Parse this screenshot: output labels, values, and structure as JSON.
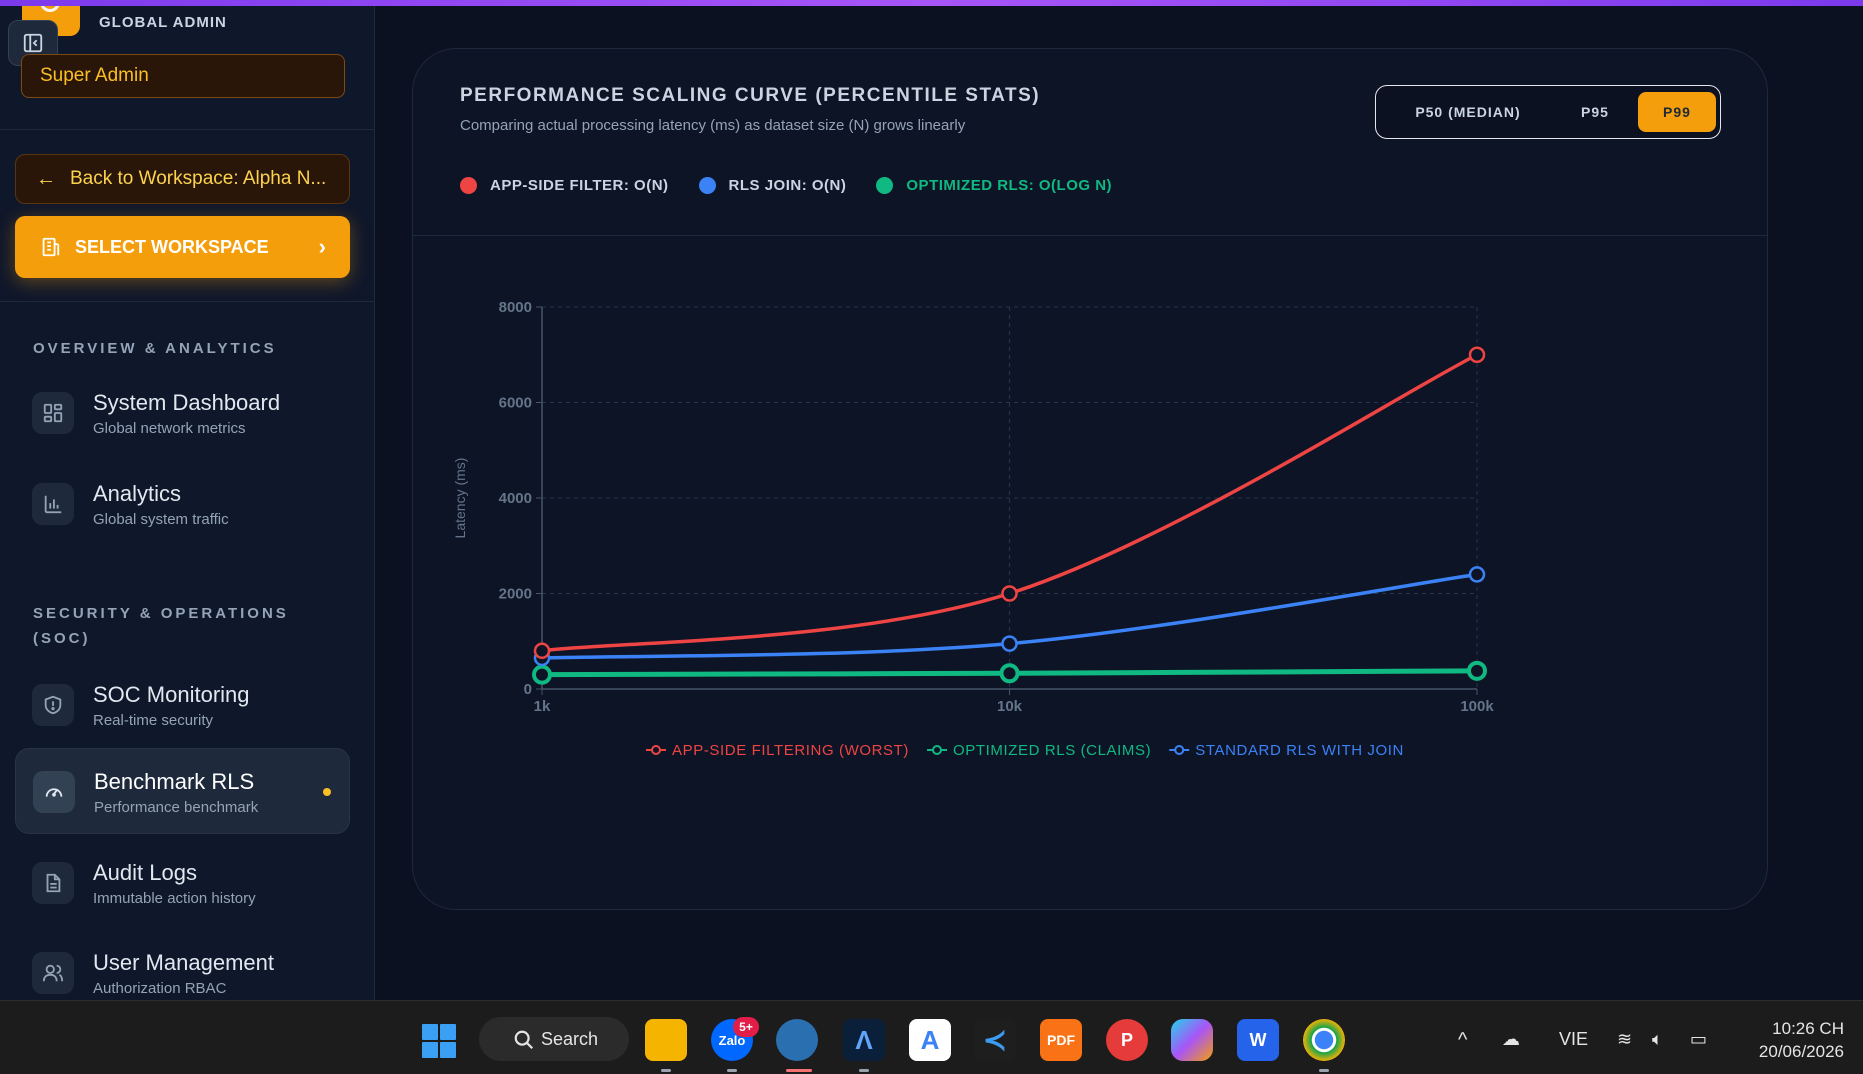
{
  "sidebar": {
    "role_header": "GLOBAL ADMIN",
    "role_badge": "Super Admin",
    "back_label": "Back to Workspace: Alpha N...",
    "select_label": "SELECT WORKSPACE",
    "sections": [
      {
        "title": "OVERVIEW & ANALYTICS"
      },
      {
        "title": "SECURITY & OPERATIONS (SOC)"
      }
    ],
    "items": [
      {
        "title": "System Dashboard",
        "subtitle": "Global network metrics",
        "icon": "dashboard-grid-icon"
      },
      {
        "title": "Analytics",
        "subtitle": "Global system traffic",
        "icon": "bar-chart-icon"
      },
      {
        "title": "SOC Monitoring",
        "subtitle": "Real-time security",
        "icon": "shield-icon"
      },
      {
        "title": "Benchmark RLS",
        "subtitle": "Performance benchmark",
        "icon": "gauge-icon",
        "active": true
      },
      {
        "title": "Audit Logs",
        "subtitle": "Immutable action history",
        "icon": "document-icon"
      },
      {
        "title": "User Management",
        "subtitle": "Authorization RBAC",
        "icon": "users-icon"
      }
    ]
  },
  "card": {
    "title": "PERFORMANCE SCALING CURVE (PERCENTILE STATS)",
    "subtitle": "Comparing actual processing latency (ms) as dataset size (N) grows linearly",
    "percentile_options": [
      "P50 (MEDIAN)",
      "P95",
      "P99"
    ],
    "selected_percentile": "P99",
    "legend_top": [
      {
        "label": "APP-SIDE FILTER: O(N)",
        "color": "#ef4444"
      },
      {
        "label": "RLS JOIN: O(N)",
        "color": "#3b82f6"
      },
      {
        "label": "OPTIMIZED RLS: O(LOG N)",
        "color": "#10b981"
      }
    ]
  },
  "chart_data": {
    "type": "line",
    "x": [
      "1k",
      "10k",
      "100k"
    ],
    "ylabel": "Latency (ms)",
    "ylim": [
      0,
      8000
    ],
    "yticks": [
      0,
      2000,
      4000,
      6000,
      8000
    ],
    "grid": true,
    "legend_position": "bottom",
    "series": [
      {
        "name": "APP-SIDE FILTERING (WORST)",
        "color": "#ef4444",
        "values": [
          800,
          2000,
          7000
        ]
      },
      {
        "name": "OPTIMIZED RLS (CLAIMS)",
        "color": "#10b981",
        "values": [
          300,
          330,
          380
        ]
      },
      {
        "name": "STANDARD RLS WITH JOIN",
        "color": "#3b82f6",
        "values": [
          650,
          950,
          2400
        ]
      }
    ]
  },
  "taskbar": {
    "search_label": "Search",
    "zalo_badge": "5+",
    "language": "VIE",
    "time": "10:26 CH",
    "date": "20/06/2026"
  }
}
